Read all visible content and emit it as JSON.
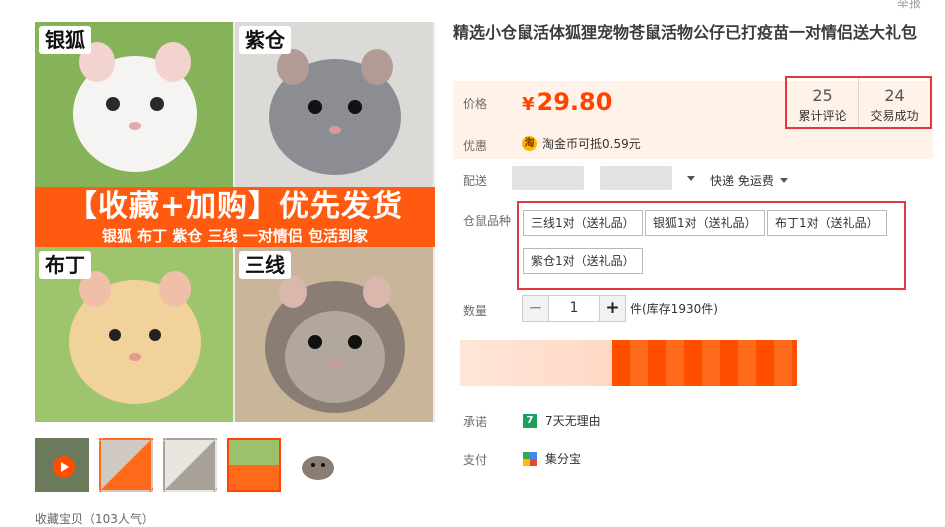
{
  "header": {
    "report_label": "举报"
  },
  "product": {
    "title": "精选小仓鼠活体狐狸宠物苍鼠活物公仔已打疫苗一对情侣送大礼包"
  },
  "gallery": {
    "tiles": [
      {
        "label": "银狐",
        "color": "#f4f2f0"
      },
      {
        "label": "紫仓",
        "color": "#8c8d93"
      },
      {
        "label": "布丁",
        "color": "#f2d29b"
      },
      {
        "label": "三线",
        "color": "#8a7e74"
      }
    ],
    "promo_main": "【收藏+加购】优先发货",
    "promo_sub": "银狐 布丁 紫仓 三线    一对情侣 包活到家",
    "thumbnails": [
      "video-thumb",
      "grid-thumb-1",
      "grid-thumb-2",
      "grid-thumb-3",
      "hamster-thumb"
    ],
    "favorite_text": "收藏宝贝（103人气）"
  },
  "price": {
    "label": "价格",
    "currency": "¥",
    "value": "29.80",
    "accent_color": "#ff4400"
  },
  "stats": {
    "reviews_count": "25",
    "reviews_label": "累计评论",
    "deals_count": "24",
    "deals_label": "交易成功"
  },
  "promo_row": {
    "label": "优惠",
    "coin_glyph": "淘",
    "text": "淘金币可抵0.59元"
  },
  "shipping": {
    "label": "配送",
    "method": "快递 免运费"
  },
  "sku": {
    "label": "仓鼠品种",
    "options": [
      "三线1对（送礼品）",
      "银狐1对（送礼品）",
      "布丁1对（送礼品）",
      "紫仓1对（送礼品）"
    ]
  },
  "quantity": {
    "label": "数量",
    "value": "1",
    "minus": "−",
    "plus": "+",
    "stock_text": "件(库存1930件)"
  },
  "promise": {
    "label": "承诺",
    "badge": "7",
    "text": "7天无理由"
  },
  "payment": {
    "label": "支付",
    "text": "集分宝"
  }
}
